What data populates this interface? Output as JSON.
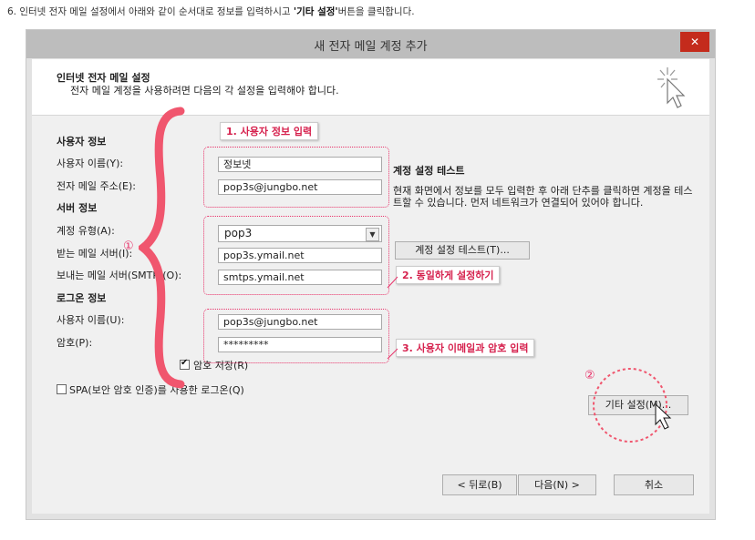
{
  "instruction": {
    "prefix": "6.   인터넷 전자 메일 설정에서 아래와 같이 순서대로 정보를 입력하시고 ",
    "emphasis": "'기타 설정'",
    "suffix": "버튼을 클릭합니다."
  },
  "window": {
    "title": "새 전자 메일 계정 추가",
    "close_label": "✕"
  },
  "header": {
    "title": "인터넷 전자 메일 설정",
    "subtitle": "전자 메일 계정을 사용하려면 다음의 각 설정을 입력해야 합니다."
  },
  "user_info": {
    "section": "사용자 정보",
    "name_label": "사용자 이름(Y):",
    "name_value": "정보넷",
    "email_label": "전자 메일 주소(E):",
    "email_value": "pop3s@jungbo.net"
  },
  "server_info": {
    "section": "서버 정보",
    "type_label": "계정 유형(A):",
    "type_value": "pop3",
    "incoming_label": "받는 메일 서버(I):",
    "incoming_value": "pop3s.ymail.net",
    "outgoing_label": "보내는 메일 서버(SMTP)(O):",
    "outgoing_value": "smtps.ymail.net"
  },
  "logon_info": {
    "section": "로그온 정보",
    "user_label": "사용자 이름(U):",
    "user_value": "pop3s@jungbo.net",
    "password_label": "암호(P):",
    "password_value": "*********",
    "remember_label": "암호 저장(R)",
    "remember_checked": true,
    "spa_label": "SPA(보안 암호 인증)를 사용한 로그온(Q)",
    "spa_checked": false
  },
  "test": {
    "title": "계정 설정 테스트",
    "description": "현재 화면에서 정보를 모두 입력한 후 아래 단추를 클릭하면 계정을 테스트할 수 있습니다. 먼저 네트워크가 연결되어 있어야 합니다.",
    "button": "계정 설정 테스트(T)..."
  },
  "more_settings_button": "기타 설정(M)...",
  "footer": {
    "back": "< 뒤로(B)",
    "next": "다음(N) >",
    "cancel": "취소"
  },
  "annotations": {
    "step1": "1. 사용자 정보 입력",
    "step2": "2. 동일하게 설정하기",
    "step3": "3. 사용자 이메일과 암호 입력",
    "marker1": "①",
    "marker2": "②",
    "accent_color": "#e8336a"
  }
}
